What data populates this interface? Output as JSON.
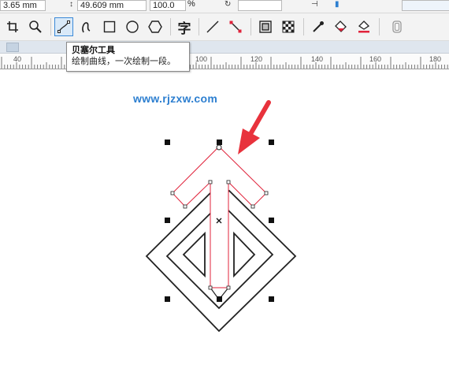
{
  "property_bar": {
    "x_value": "3.65 mm",
    "y_value": "49.609 mm",
    "scale_value": "100.0",
    "scale_unit": "%"
  },
  "toolbar": {
    "tools": [
      {
        "name": "crop-tool",
        "icon": "crop-icon"
      },
      {
        "name": "zoom-tool",
        "icon": "zoom-icon"
      },
      {
        "name": "bezier-tool",
        "icon": "bezier-icon",
        "active": true
      },
      {
        "name": "artistic-media-tool",
        "icon": "artistic-media-icon"
      },
      {
        "name": "rectangle-tool",
        "icon": "rectangle-icon"
      },
      {
        "name": "ellipse-tool",
        "icon": "ellipse-icon"
      },
      {
        "name": "polygon-tool",
        "icon": "polygon-icon"
      },
      {
        "name": "text-tool",
        "icon": "text-icon",
        "label": "字"
      },
      {
        "name": "parallel-dimension-tool",
        "icon": "dimension-icon"
      },
      {
        "name": "connector-tool",
        "icon": "connector-icon"
      },
      {
        "name": "drop-shadow-tool",
        "icon": "shadow-icon"
      },
      {
        "name": "transparency-tool",
        "icon": "transparency-icon"
      },
      {
        "name": "eyedropper-tool",
        "icon": "eyedropper-icon"
      },
      {
        "name": "interactive-fill-tool",
        "icon": "fill-icon"
      },
      {
        "name": "smart-fill-tool",
        "icon": "smart-fill-icon"
      },
      {
        "name": "extra-tool",
        "icon": "phone-icon"
      }
    ]
  },
  "ruler": {
    "labels": [
      "40",
      "100",
      "120",
      "140",
      "160",
      "180"
    ]
  },
  "tooltip": {
    "title": "贝塞尔工具",
    "description": "绘制曲线，一次绘制一段。"
  },
  "watermark": "www.rjzxw.com",
  "colors": {
    "accent": "#3c8ad8",
    "selected_path": "#e0233b",
    "arrow": "#e8323c",
    "watermark": "#2d7fd0"
  }
}
